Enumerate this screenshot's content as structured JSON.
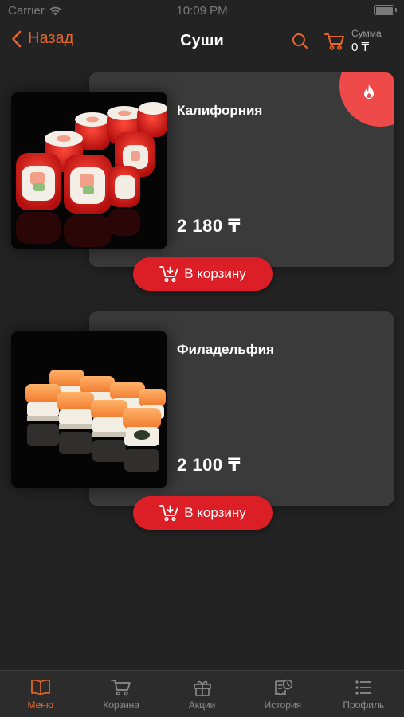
{
  "status_bar": {
    "carrier": "Carrier",
    "time": "10:09 PM"
  },
  "nav": {
    "back_label": "Назад",
    "title": "Суши",
    "sum_label": "Сумма",
    "sum_value": "0 ₸"
  },
  "products": [
    {
      "name": "Калифорния",
      "price": "2 180 ₸",
      "button_label": "В корзину",
      "hot": true
    },
    {
      "name": "Филадельфия",
      "price": "2 100 ₸",
      "button_label": "В корзину",
      "hot": false
    }
  ],
  "tabs": [
    {
      "label": "Меню",
      "icon": "book-icon",
      "active": true
    },
    {
      "label": "Корзина",
      "icon": "cart-icon",
      "active": false
    },
    {
      "label": "Акции",
      "icon": "gift-icon",
      "active": false
    },
    {
      "label": "История",
      "icon": "history-icon",
      "active": false
    },
    {
      "label": "Профиль",
      "icon": "list-icon",
      "active": false
    }
  ],
  "colors": {
    "accent": "#e8662c",
    "button": "#dc1f27",
    "hot_badge": "#ef4a4a",
    "background": "#232323",
    "card": "#3a3a3a"
  }
}
